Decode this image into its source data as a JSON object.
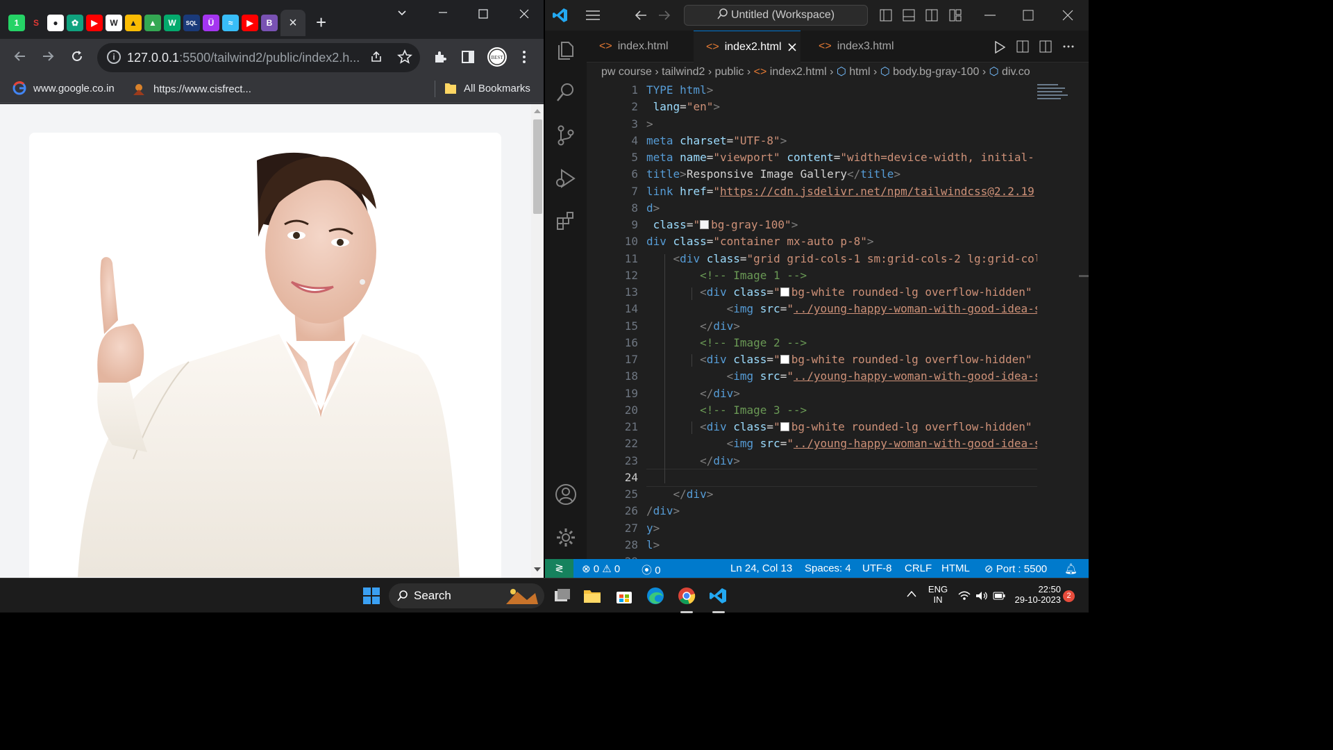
{
  "browser": {
    "tab_close": "×",
    "new_tab": "+",
    "url_host": "127.0.0.1",
    "url_rest": ":5500/tailwind2/public/index2.h...",
    "bookmarks": [
      {
        "label": "www.google.co.in"
      },
      {
        "label": "https://www.cisfrect..."
      }
    ],
    "all_bookmarks": "All Bookmarks",
    "favicons": [
      {
        "icon": "whatsapp-icon",
        "color": "#25d366",
        "glyph": "1"
      },
      {
        "icon": "s-icon",
        "color": "#202124",
        "glyph": "S"
      },
      {
        "icon": "github-icon",
        "color": "#ffffff",
        "glyph": "●"
      },
      {
        "icon": "chatgpt-icon",
        "color": "#10a37f",
        "glyph": "✿"
      },
      {
        "icon": "youtube-icon",
        "color": "#ff0000",
        "glyph": "▶"
      },
      {
        "icon": "wordpress-icon",
        "color": "#ffffff",
        "glyph": "W"
      },
      {
        "icon": "drive-icon",
        "color": "#fbbc04",
        "glyph": "▲"
      },
      {
        "icon": "drive-icon-2",
        "color": "#34a853",
        "glyph": "▲"
      },
      {
        "icon": "w3schools-icon",
        "color": "#04aa6d",
        "glyph": "W"
      },
      {
        "icon": "sql-icon",
        "color": "#1a3a7a",
        "glyph": "SQL"
      },
      {
        "icon": "udemy-icon",
        "color": "#a435f0",
        "glyph": "Ü"
      },
      {
        "icon": "tailwind-icon",
        "color": "#38bdf8",
        "glyph": "≈"
      },
      {
        "icon": "youtube-icon-2",
        "color": "#ff0000",
        "glyph": "▶"
      },
      {
        "icon": "bootstrap-icon",
        "color": "#7952b3",
        "glyph": "B"
      }
    ]
  },
  "vscode": {
    "command_center": "Untitled (Workspace)",
    "tabs": [
      {
        "label": "index.html"
      },
      {
        "label": "index2.html"
      },
      {
        "label": "index3.html"
      }
    ],
    "breadcrumbs": [
      "pw course",
      "tailwind2",
      "public",
      "index2.html",
      "html",
      "body.bg-gray-100",
      "div.co"
    ],
    "current_line": 24,
    "status": {
      "errors": "0",
      "warnings": "0",
      "ports": "0",
      "position": "Ln 24, Col 13",
      "spaces": "Spaces: 4",
      "encoding": "UTF-8",
      "eol": "CRLF",
      "language": "HTML",
      "port": "Port : 5500"
    }
  },
  "taskbar": {
    "search": "Search",
    "lang1": "ENG",
    "lang2": "IN",
    "time": "22:50",
    "date": "29-10-2023",
    "notifications": "2"
  }
}
